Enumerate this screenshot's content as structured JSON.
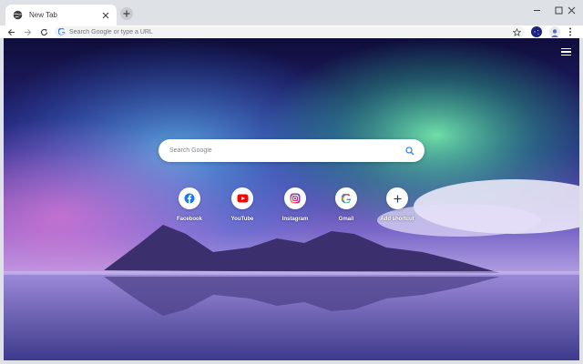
{
  "tab": {
    "title": "New Tab"
  },
  "omnibox": {
    "placeholder": "Search Google or type a URL"
  },
  "search": {
    "placeholder": "Search Google"
  },
  "shortcuts": [
    {
      "label": "Facebook",
      "icon": "facebook-icon"
    },
    {
      "label": "YouTube",
      "icon": "youtube-icon"
    },
    {
      "label": "Instagram",
      "icon": "instagram-icon"
    },
    {
      "label": "Gmail",
      "icon": "google-icon"
    },
    {
      "label": "Add shortcut",
      "icon": "plus-icon"
    }
  ],
  "colors": {
    "chrome_bg": "#dee1e6",
    "google_blue": "#4285f4",
    "youtube_red": "#ff0000",
    "facebook_blue": "#1877f2"
  }
}
